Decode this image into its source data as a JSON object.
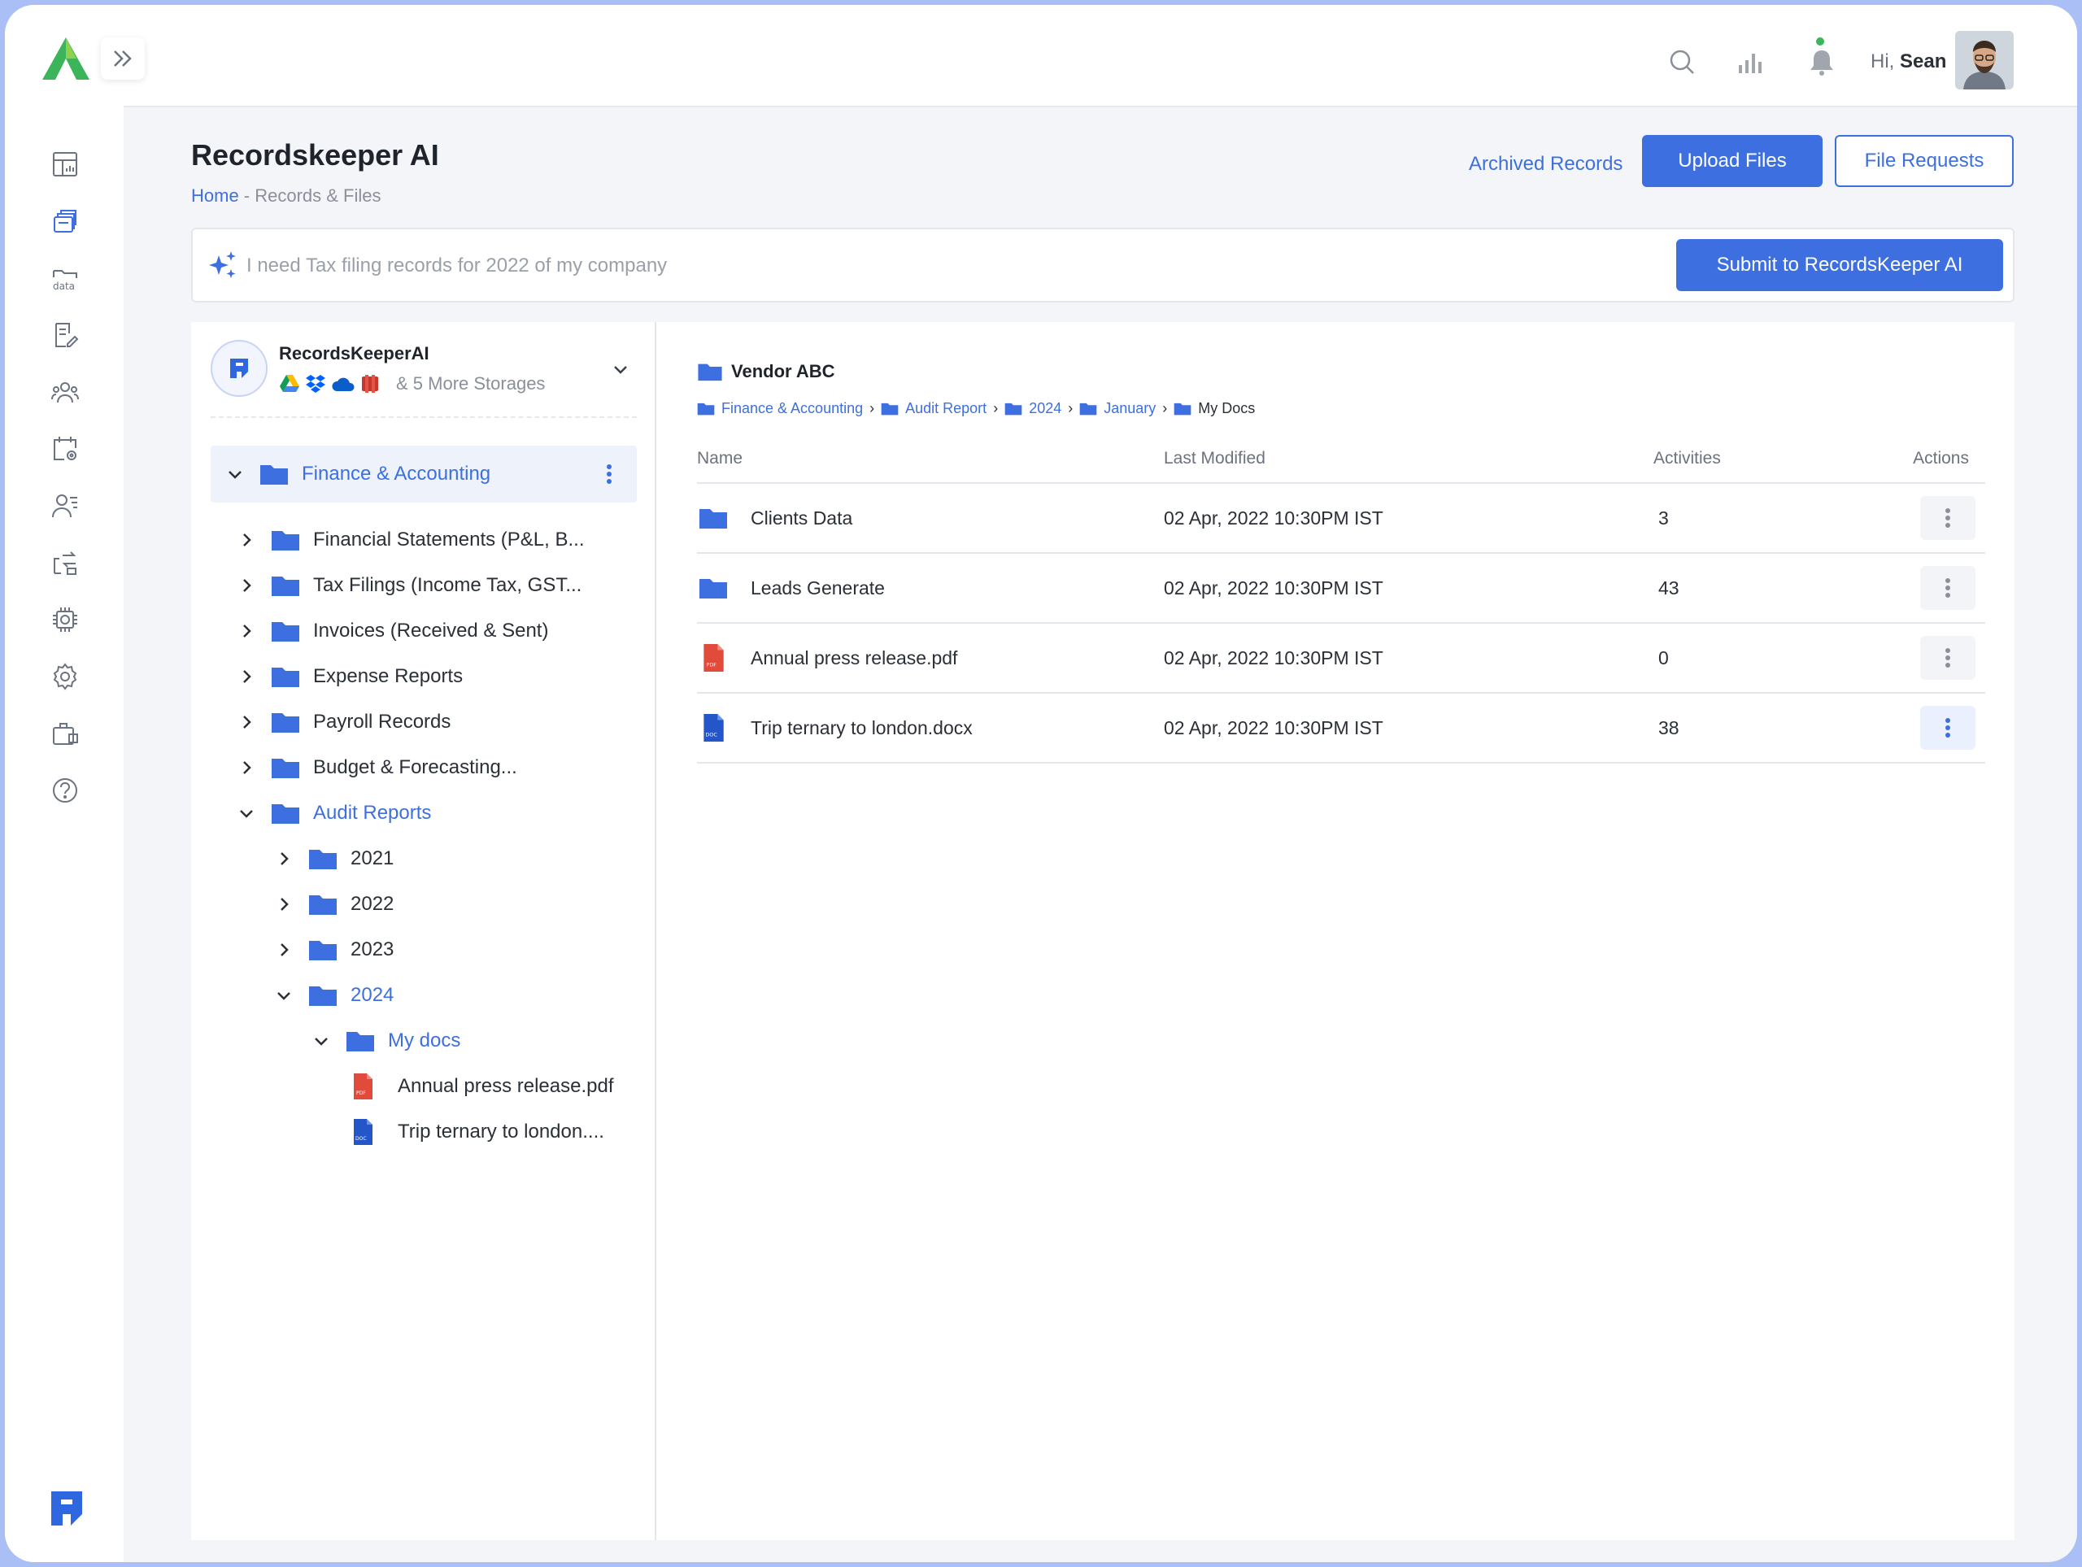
{
  "header": {
    "greeting_prefix": "Hi,",
    "user_name": "Sean"
  },
  "page": {
    "title": "Recordskeeper AI",
    "breadcrumb_home": "Home",
    "breadcrumb_rest": " - Records & Files",
    "archived_label": "Archived Records",
    "upload_label": "Upload Files",
    "requests_label": "File Requests"
  },
  "ai": {
    "placeholder": "I need Tax filing records for 2022 of my company",
    "submit_label": "Submit to RecordsKeeper AI"
  },
  "storage": {
    "name": "RecordsKeeperAI",
    "more": "& 5 More Storages"
  },
  "tree": {
    "root": "Finance & Accounting",
    "items": [
      "Financial Statements (P&L, B...",
      "Tax Filings (Income Tax, GST...",
      "Invoices (Received & Sent)",
      "Expense Reports",
      "Payroll Records",
      "Budget & Forecasting...",
      "Audit Reports"
    ],
    "years": [
      "2021",
      "2022",
      "2023",
      "2024"
    ],
    "subfolder": "My docs",
    "files": [
      "Annual press release.pdf",
      "Trip ternary to london...."
    ]
  },
  "main": {
    "folder_title": "Vendor ABC",
    "crumbs": [
      "Finance & Accounting",
      "Audit Report",
      "2024",
      "January",
      "My Docs"
    ],
    "columns": {
      "name": "Name",
      "modified": "Last Modified",
      "activities": "Activities",
      "actions": "Actions"
    },
    "rows": [
      {
        "name": "Clients Data",
        "type": "folder",
        "modified": "02 Apr, 2022 10:30PM IST",
        "activities": "3"
      },
      {
        "name": "Leads Generate",
        "type": "folder",
        "modified": "02 Apr, 2022 10:30PM IST",
        "activities": "43"
      },
      {
        "name": "Annual press release.pdf",
        "type": "pdf",
        "modified": "02 Apr, 2022 10:30PM IST",
        "activities": "0"
      },
      {
        "name": "Trip ternary to london.docx",
        "type": "doc",
        "modified": "02 Apr, 2022 10:30PM IST",
        "activities": "38"
      }
    ]
  },
  "colors": {
    "accent": "#3d6fe0",
    "brand_green": "#3cb55a",
    "pdf_red": "#e04b3c",
    "doc_blue": "#2456c9"
  }
}
